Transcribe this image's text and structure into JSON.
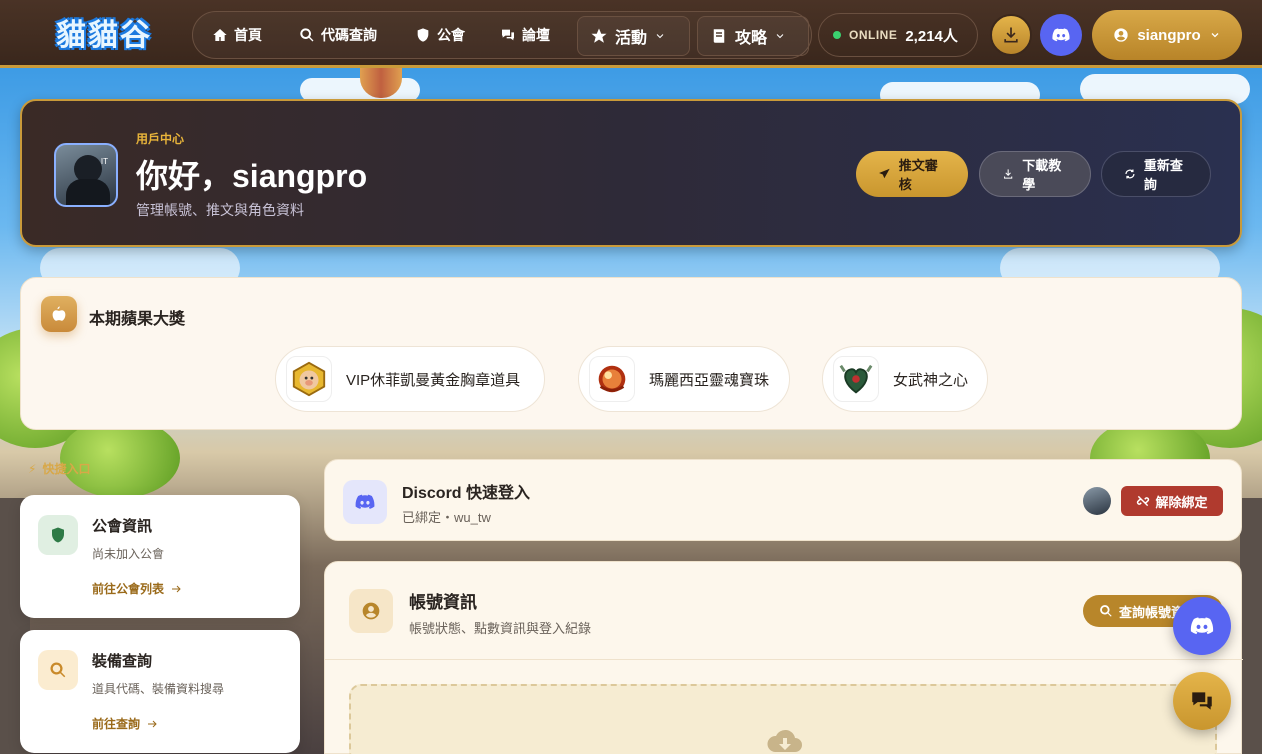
{
  "brand": {
    "logo_text": "貓貓谷"
  },
  "nav": {
    "home": "首頁",
    "code_query": "代碼查詢",
    "guild": "公會",
    "forum": "論壇",
    "events": "活動",
    "guides": "攻略"
  },
  "online": {
    "label": "ONLINE",
    "count": "2,214人",
    "status_color": "#3bd16f"
  },
  "user": {
    "name": "siangpro"
  },
  "hero": {
    "kicker": "用戶中心",
    "greeting": "你好，siangpro",
    "subtitle": "管理帳號、推文與角色資料",
    "avatar_tag": "IT",
    "buttons": {
      "review": "推文審核",
      "download_guide": "下載教學",
      "refresh": "重新查詢"
    }
  },
  "award": {
    "title": "本期蘋果大獎",
    "items": [
      {
        "label": "VIP休菲凱曼黃金胸章道具",
        "icon": "pig-badge-icon"
      },
      {
        "label": "瑪麗西亞靈魂寶珠",
        "icon": "soul-orb-icon"
      },
      {
        "label": "女武神之心",
        "icon": "valkyrie-heart-icon"
      }
    ]
  },
  "sidebar": {
    "section_label": "快捷入口",
    "cards": [
      {
        "title": "公會資訊",
        "desc": "尚未加入公會",
        "link": "前往公會列表"
      },
      {
        "title": "裝備查詢",
        "desc": "道具代碼、裝備資料搜尋",
        "link": "前往查詢"
      }
    ]
  },
  "discord": {
    "title": "Discord 快速登入",
    "status": "已綁定・wu_tw",
    "unbind_label": "解除綁定"
  },
  "account": {
    "title": "帳號資訊",
    "subtitle": "帳號狀態、點數資訊與登入紀錄",
    "query_label": "查詢帳號資訊"
  },
  "colors": {
    "gold": "#c99a3a",
    "discord": "#5865f2",
    "danger": "#b03a2e"
  }
}
